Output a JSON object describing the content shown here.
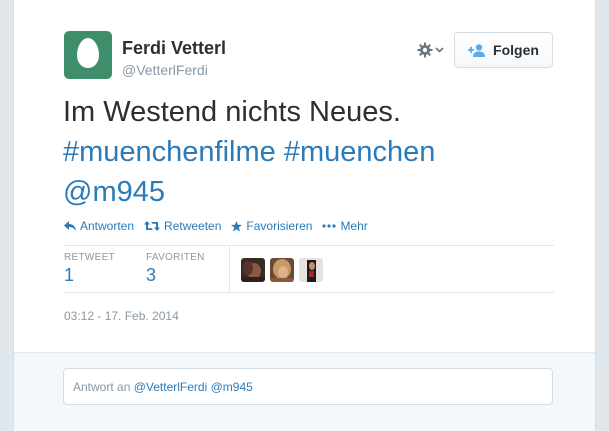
{
  "user": {
    "name": "Ferdi Vetterl",
    "handle": "@VetterlFerdi"
  },
  "header": {
    "follow_label": "Folgen"
  },
  "tweet": {
    "line1": "Im Westend nichts Neues.",
    "hashtag1": "#muenchenfilme",
    "hashtag2": "#muenchen",
    "mention": "@m945"
  },
  "actions": [
    {
      "label": "Antworten",
      "icon": "reply-icon"
    },
    {
      "label": "Retweeten",
      "icon": "retweet-icon"
    },
    {
      "label": "Favorisieren",
      "icon": "star-icon"
    },
    {
      "label": "Mehr",
      "icon": "more-icon"
    }
  ],
  "stats": {
    "retweets_label": "RETWEET",
    "retweets_value": "1",
    "favorites_label": "FAVORITEN",
    "favorites_value": "3"
  },
  "timestamp": "03:12 - 17. Feb. 2014",
  "reply": {
    "prefix": "Antwort an",
    "mentions": "@VetterlFerdi @m945"
  },
  "colors": {
    "link": "#2b7bb9",
    "avatar_bg": "#3e8e6b",
    "muted": "#8899a6"
  }
}
